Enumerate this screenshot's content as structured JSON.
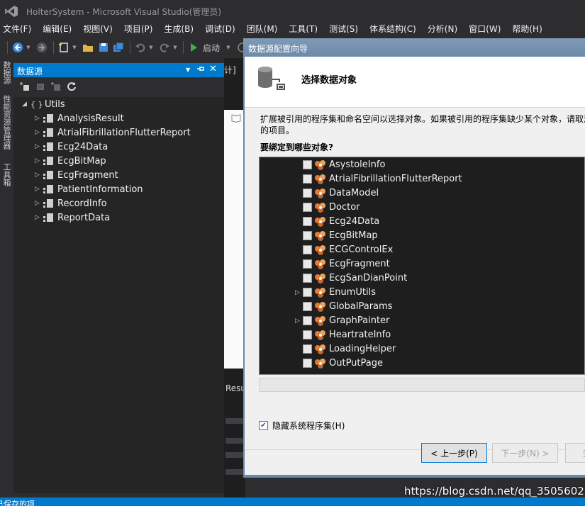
{
  "window": {
    "title": "HolterSystem - Microsoft Visual Studio(管理员)"
  },
  "menu": [
    "文件(F)",
    "编辑(E)",
    "视图(V)",
    "项目(P)",
    "生成(B)",
    "调试(D)",
    "团队(M)",
    "工具(T)",
    "测试(S)",
    "体系结构(C)",
    "分析(N)",
    "窗口(W)",
    "帮助(H)"
  ],
  "toolbar": {
    "start_label": "启动"
  },
  "side_tabs": [
    "数据源",
    "性能资源管理器",
    "工具箱"
  ],
  "datasources_panel": {
    "title": "数据源",
    "namespace": "Utils",
    "namespace_icon": "{ }",
    "items": [
      "AnalysisResult",
      "AtrialFibrillationFlutterReport",
      "Ecg24Data",
      "EcgBitMap",
      "EcgFragment",
      "PatientInformation",
      "RecordInfo",
      "ReportData"
    ]
  },
  "editor": {
    "tab_fragment": "计]",
    "output_fragment": "Resu"
  },
  "status": {
    "text": "已保存的项"
  },
  "dialog": {
    "title": "数据源配置向导",
    "heading": "选择数据对象",
    "description_line1": "扩展被引用的程序集和命名空间以选择对象。如果被引用的程序集缺少某个对象，请取消",
    "description_line2": "的项目。",
    "question": "要绑定到哪些对象?",
    "objects": [
      {
        "label": "AsystoleInfo",
        "expandable": false
      },
      {
        "label": "AtrialFibrillationFlutterReport",
        "expandable": false
      },
      {
        "label": "DataModel",
        "expandable": false
      },
      {
        "label": "Doctor",
        "expandable": false
      },
      {
        "label": "Ecg24Data",
        "expandable": false
      },
      {
        "label": "EcgBitMap",
        "expandable": false
      },
      {
        "label": "ECGControlEx",
        "expandable": false
      },
      {
        "label": "EcgFragment",
        "expandable": false
      },
      {
        "label": "EcgSanDianPoint",
        "expandable": false
      },
      {
        "label": "EnumUtils",
        "expandable": true
      },
      {
        "label": "GlobalParams",
        "expandable": false
      },
      {
        "label": "GraphPainter",
        "expandable": true
      },
      {
        "label": "HeartrateInfo",
        "expandable": false
      },
      {
        "label": "LoadingHelper",
        "expandable": false
      },
      {
        "label": "OutPutPage",
        "expandable": false
      }
    ],
    "hide_system_assemblies": {
      "label": "隐藏系统程序集(H)",
      "checked": true
    },
    "buttons": {
      "previous": "< 上一步(P)",
      "next": "下一步(N) >",
      "finish": "完"
    }
  },
  "watermark": "https://blog.csdn.net/qq_35056027",
  "colors": {
    "accent": "#007acc",
    "background": "#2d2d30",
    "dialog_frame": "#6b8aaa"
  }
}
